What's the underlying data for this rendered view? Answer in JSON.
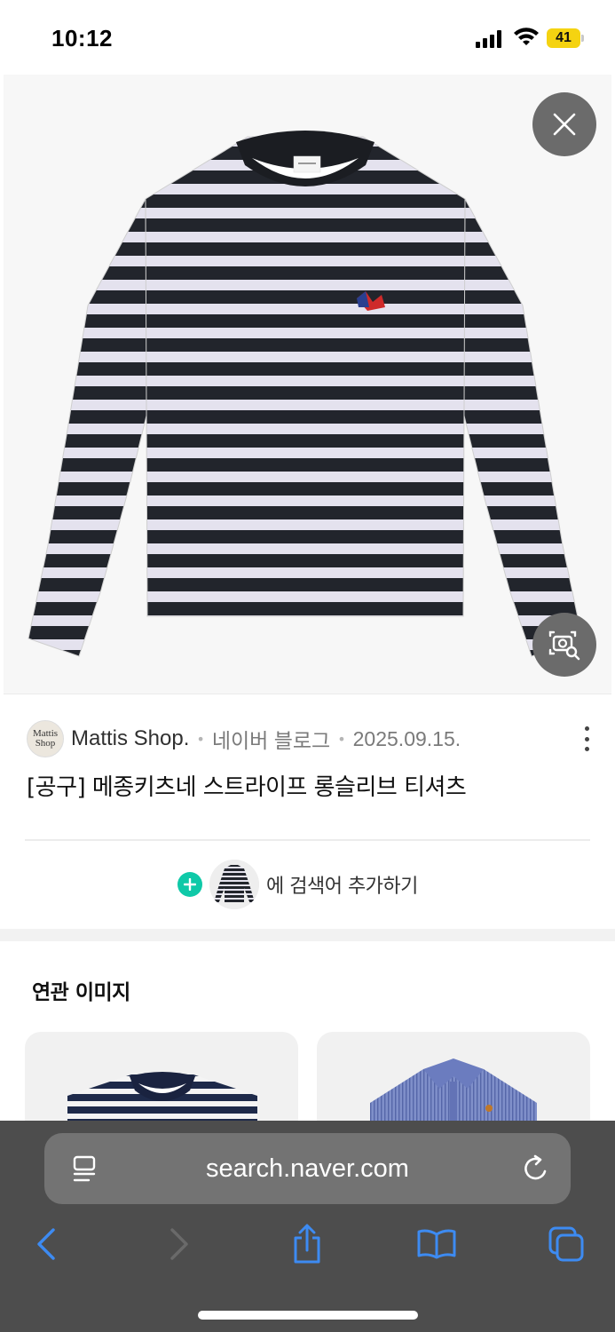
{
  "status_bar": {
    "time": "10:12",
    "battery_level": "41",
    "icons": [
      "signal-icon",
      "wifi-icon",
      "battery-icon"
    ]
  },
  "image_viewer": {
    "close_icon": "close-icon",
    "lens_icon": "image-search-icon"
  },
  "result": {
    "source_logo_line1": "Mattis",
    "source_logo_line2": "Shop",
    "source_name": "Mattis Shop.",
    "platform": "네이버 블로그",
    "date": "2025.09.15.",
    "title": "[공구] 메종키츠네 스트라이프 롱슬리브 티셔츠",
    "add_search_label": "에 검색어 추가하기"
  },
  "related": {
    "title": "연관 이미지"
  },
  "browser": {
    "url": "search.naver.com",
    "accent": "#3d8bf2"
  },
  "colors": {
    "stripe_dark": "#22252c",
    "stripe_light": "#e4e2ee",
    "battery": "#f5d311",
    "add_plus": "#0fc9a8"
  }
}
